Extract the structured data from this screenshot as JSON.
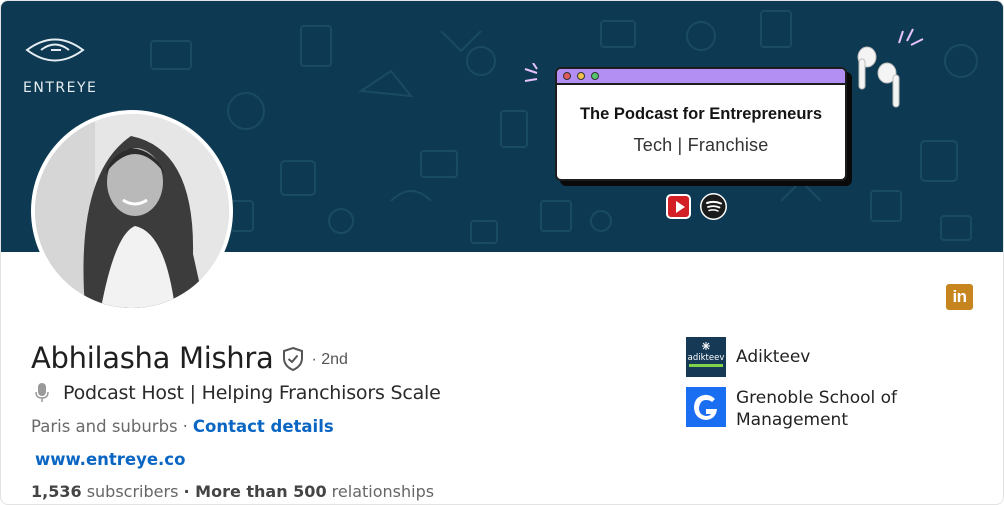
{
  "banner": {
    "brand_name": "ENTREYE",
    "podcast_title": "The Podcast for Entrepreneurs",
    "podcast_subtitle": "Tech | Franchise"
  },
  "badge": {
    "label": "in",
    "color": "#c7851f"
  },
  "profile": {
    "name": "Abhilasha Mishra",
    "degree": "· 2nd",
    "headline": "Podcast Host | Helping Franchisors Scale",
    "location": "Paris and suburbs",
    "separator": "·",
    "contact_label": "Contact details",
    "website": "www.entreye.co",
    "subscribers_count": "1,536",
    "subscribers_label": "subscribers",
    "connections_prefix": "· More than 500",
    "connections_label": "relationships"
  },
  "companies": [
    {
      "name": "Adikteev",
      "logo_text": "adikteev",
      "logo_color": "#163a55"
    },
    {
      "name": "Grenoble School of Management",
      "logo_color": "#1a6ef2"
    }
  ],
  "colors": {
    "banner_bg": "#0d3a52",
    "link": "#0a66c2",
    "window_bar": "#b38ef3"
  }
}
